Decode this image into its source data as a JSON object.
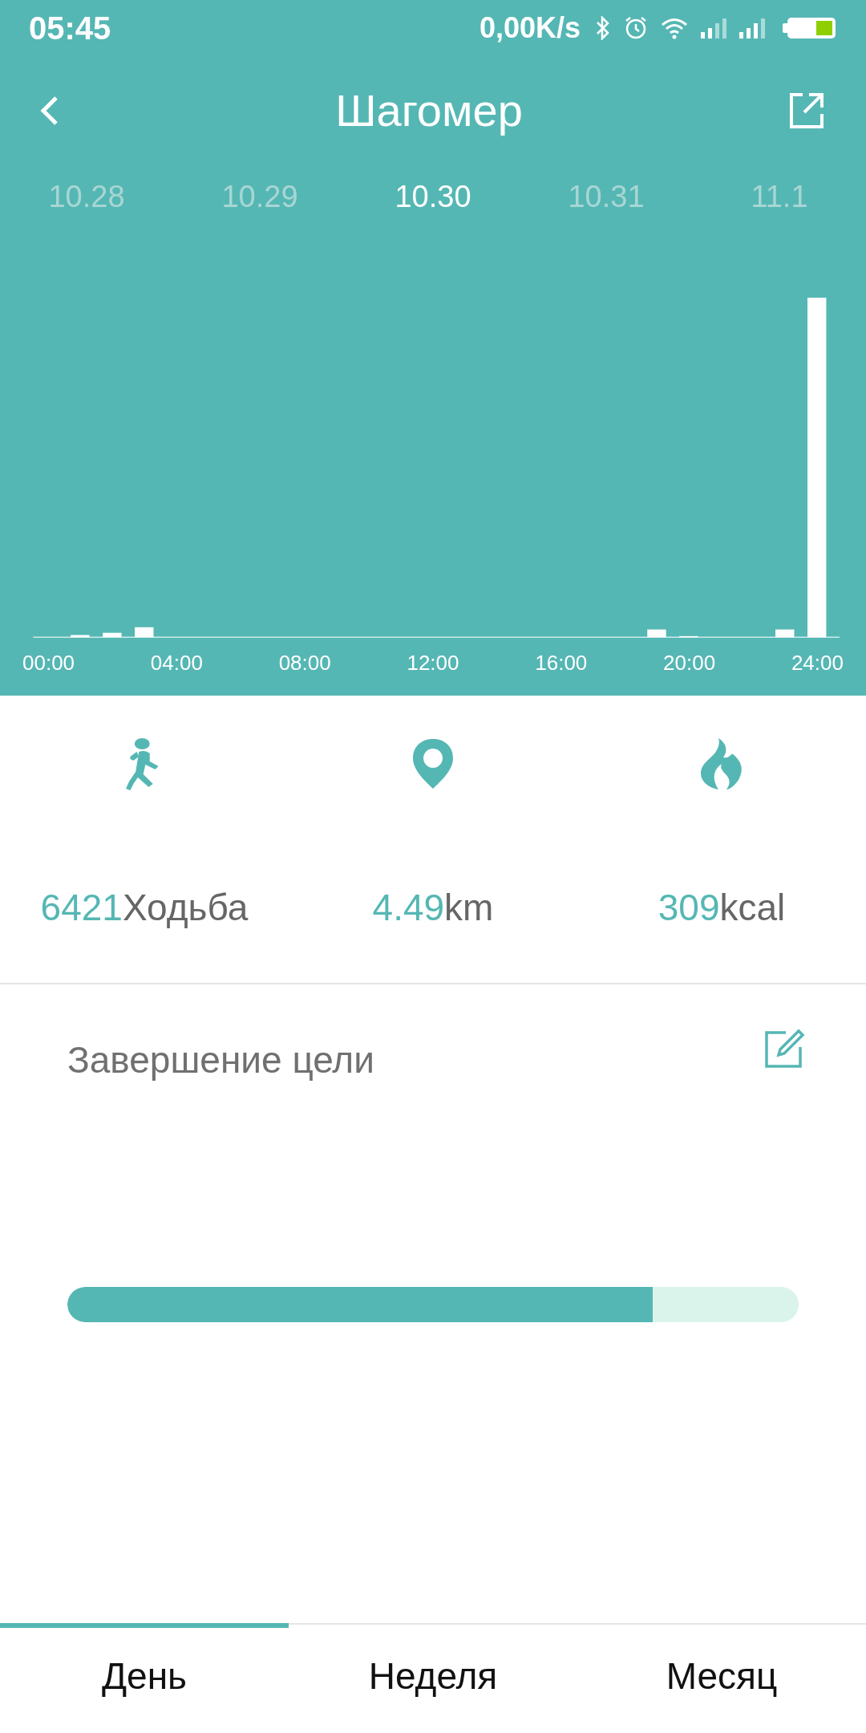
{
  "status_bar": {
    "time": "05:45",
    "speed": "0,00K/s"
  },
  "header": {
    "title": "Шагомер"
  },
  "dates": [
    {
      "label": "10.28",
      "selected": false
    },
    {
      "label": "10.29",
      "selected": false
    },
    {
      "label": "10.30",
      "selected": true
    },
    {
      "label": "10.31",
      "selected": false
    },
    {
      "label": "11.1",
      "selected": false
    }
  ],
  "chart": {
    "x_labels": [
      "00:00",
      "04:00",
      "08:00",
      "12:00",
      "16:00",
      "20:00",
      "24:00"
    ]
  },
  "stats": [
    {
      "kind": "steps",
      "value": "6421",
      "unit": "Ходьба"
    },
    {
      "kind": "distance",
      "value": "4.49",
      "unit": "km"
    },
    {
      "kind": "calories",
      "value": "309",
      "unit": "kcal"
    }
  ],
  "goal": {
    "title": "Завершение цели",
    "level": 0.8
  },
  "tabs": [
    {
      "label": "День",
      "selected": true
    },
    {
      "label": "Неделя",
      "selected": false
    },
    {
      "label": "Месяц",
      "selected": false
    }
  ]
}
